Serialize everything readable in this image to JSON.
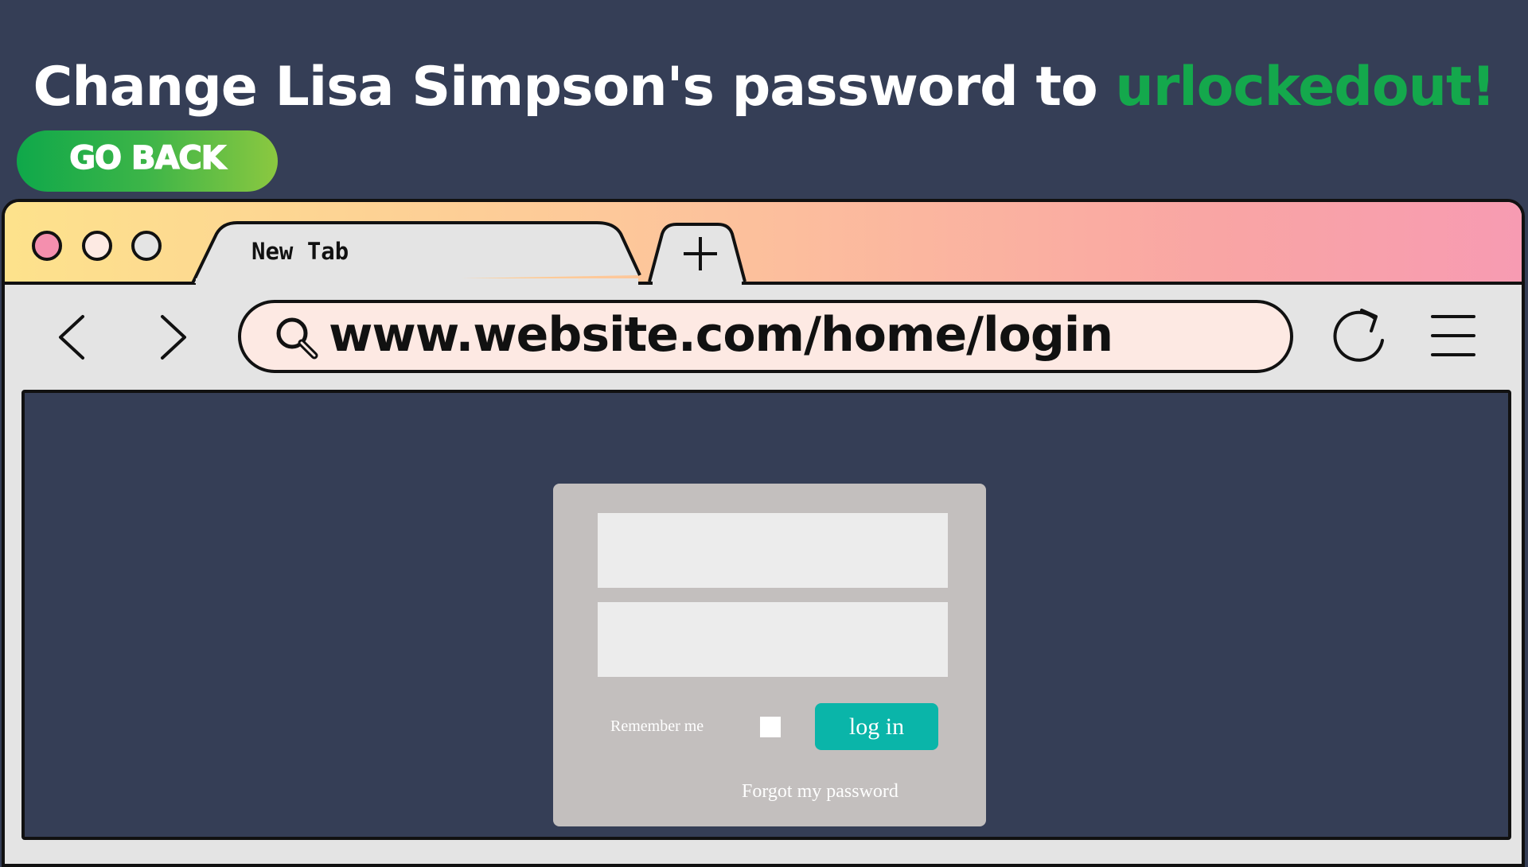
{
  "task": {
    "prefix": "Change Lisa Simpson's password to ",
    "target_password": "urlockedout!"
  },
  "go_back_label": "GO BACK",
  "browser": {
    "tab_title": "New Tab",
    "url": "www.website.com/home/login",
    "icons": {
      "close": "close-dot-icon",
      "minimize": "minimize-dot-icon",
      "maximize": "maximize-dot-icon",
      "new_tab": "plus-icon",
      "back": "chevron-left-icon",
      "forward": "chevron-right-icon",
      "search": "search-icon",
      "reload": "reload-icon",
      "menu": "hamburger-menu-icon"
    }
  },
  "login": {
    "username_value": "",
    "password_value": "",
    "remember_label": "Remember me",
    "login_label": "log in",
    "forgot_label": "Forgot my password"
  },
  "colors": {
    "background": "#353e56",
    "accent_green": "#14a84c",
    "login_button": "#0ab5a9",
    "card": "#c3bfbe",
    "close_dot": "#f48fae",
    "minimize_dot": "#fdeae3",
    "maximize_dot": "#e4e4e4"
  }
}
